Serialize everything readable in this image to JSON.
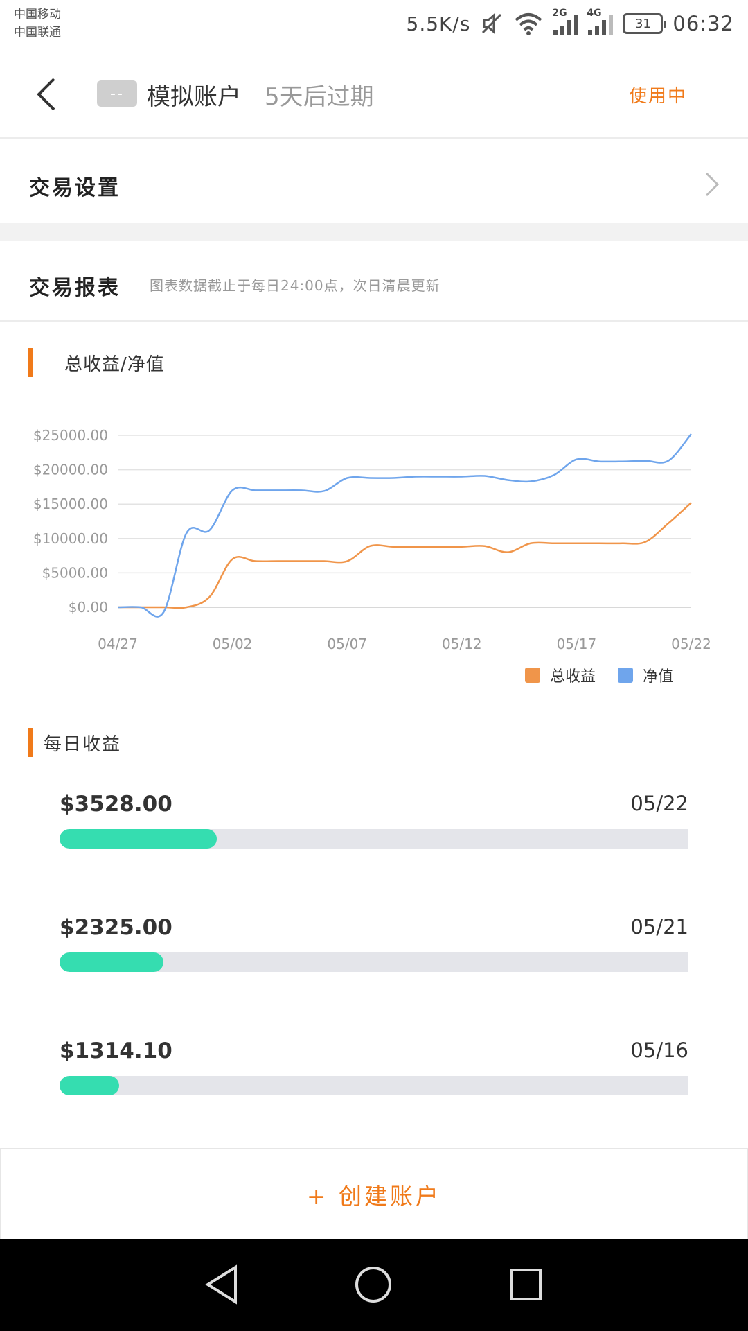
{
  "status_bar": {
    "carrier_1": "中国移动",
    "carrier_2": "中国联通",
    "net_speed": "5.5K/s",
    "sim1_tag": "2G",
    "sim2_tag": "4G",
    "battery": "31",
    "time": "06:32"
  },
  "header": {
    "badge": "--",
    "account_name": "模拟账户",
    "expire": "5天后过期",
    "status": "使用中"
  },
  "settings": {
    "title": "交易设置"
  },
  "report": {
    "title": "交易报表",
    "note": "图表数据截止于每日24:00点，次日清晨更新"
  },
  "chart_section": {
    "label": "总收益/净值"
  },
  "chart_data": {
    "type": "line",
    "x": [
      "04/27",
      "04/28",
      "04/29",
      "04/30",
      "05/01",
      "05/02",
      "05/03",
      "05/04",
      "05/05",
      "05/06",
      "05/07",
      "05/08",
      "05/09",
      "05/10",
      "05/11",
      "05/12",
      "05/13",
      "05/14",
      "05/15",
      "05/16",
      "05/17",
      "05/18",
      "05/19",
      "05/20",
      "05/21",
      "05/22"
    ],
    "x_ticks": [
      "04/27",
      "05/02",
      "05/07",
      "05/12",
      "05/17",
      "05/22"
    ],
    "y_ticks": [
      "$0.00",
      "$5000.00",
      "$10000.00",
      "$15000.00",
      "$20000.00",
      "$25000.00"
    ],
    "ylim": [
      0,
      25000
    ],
    "series": [
      {
        "name": "总收益",
        "color": "#f0954a",
        "values": [
          0,
          0,
          0,
          0,
          1500,
          7000,
          6700,
          6700,
          6700,
          6700,
          6700,
          8900,
          8800,
          8800,
          8800,
          8800,
          8900,
          8000,
          9300,
          9300,
          9300,
          9300,
          9300,
          9500,
          12200,
          15200
        ]
      },
      {
        "name": "净值",
        "color": "#6fa5ec",
        "values": [
          0,
          0,
          -700,
          10800,
          11200,
          17000,
          17000,
          17000,
          17000,
          16900,
          18800,
          18800,
          18800,
          19000,
          19000,
          19000,
          19100,
          18500,
          18300,
          19200,
          21500,
          21200,
          21200,
          21300,
          21300,
          25200
        ]
      }
    ],
    "legend_position": "bottom-right",
    "grid": true
  },
  "daily_section": {
    "label": "每日收益",
    "items": [
      {
        "amount": "$3528.00",
        "date": "05/22",
        "progress": 0.25
      },
      {
        "amount": "$2325.00",
        "date": "05/21",
        "progress": 0.165
      },
      {
        "amount": "$1314.10",
        "date": "05/16",
        "progress": 0.095
      }
    ]
  },
  "create": {
    "label": "+ 创建账户"
  },
  "colors": {
    "accent": "#f07a1a",
    "progress": "#35ddb0",
    "track": "#e4e5ea"
  },
  "icons": {
    "back": "chevron-left-icon",
    "settings_arrow": "chevron-right-icon",
    "nav_back": "triangle-back-icon",
    "nav_home": "circle-home-icon",
    "nav_recent": "square-recent-icon"
  }
}
